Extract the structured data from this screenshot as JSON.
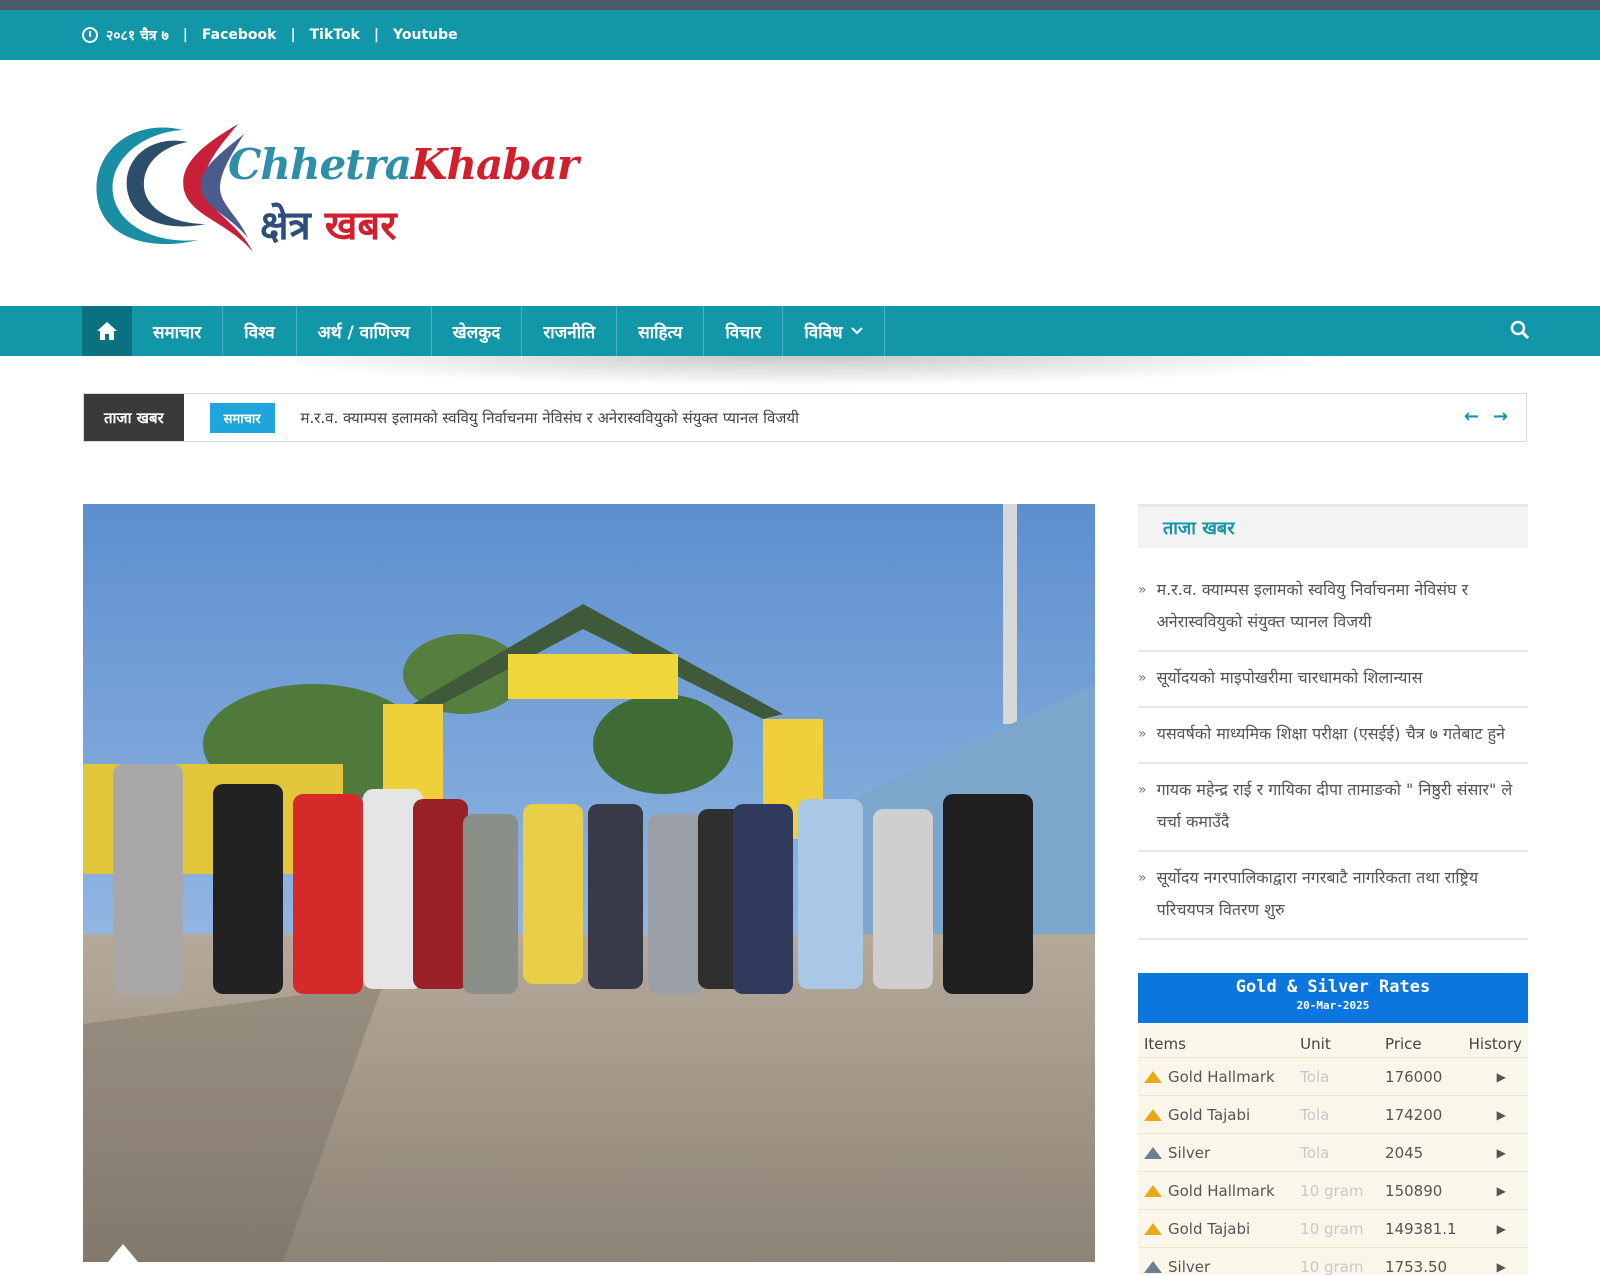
{
  "topbar": {
    "date": "२०८१ चैत्र ७",
    "links": [
      "Facebook",
      "TikTok",
      "Youtube"
    ]
  },
  "logo": {
    "latin_part1": "Chhetra",
    "latin_part2": "Khabar",
    "devanagari_part1": "क्षेत्र",
    "devanagari_part2": "खबर"
  },
  "nav": {
    "items": [
      "समाचार",
      "विश्व",
      "अर्थ / वाणिज्य",
      "खेलकुद",
      "राजनीति",
      "साहित्य",
      "विचार",
      "विविध"
    ]
  },
  "ticker": {
    "label": "ताजा खबर",
    "badge": "समाचार",
    "headline": "म.र.व. क्याम्पस इलामको स्ववियु निर्वाचनमा नेविसंघ र अनेरास्ववियुको संयुक्त प्यानल विजयी"
  },
  "sidebar": {
    "title": "ताजा खबर",
    "news": [
      "म.र.व. क्याम्पस इलामको स्ववियु निर्वाचनमा नेविसंघ र अनेरास्ववियुको संयुक्त प्यानल विजयी",
      "सूर्योदयको माइपोखरीमा चारधामको शिलान्यास",
      "यसवर्षको माध्यमिक शिक्षा परीक्षा (एसईई) चैत्र ७ गतेबाट हुने",
      "गायक महेन्द्र राई र गायिका दीपा तामाङको \" निष्ठुरी संसार\" ले चर्चा कमाउँदै",
      "सूर्योदय नगरपालिकाद्वारा नगरबाटै नागरिकता तथा राष्ट्रिय परिचयपत्र वितरण शुरु"
    ]
  },
  "gold": {
    "title": "Gold & Silver Rates",
    "date": "20-Mar-2025",
    "headers": [
      "Items",
      "Unit",
      "Price",
      "History"
    ],
    "rows": [
      {
        "item": "Gold Hallmark",
        "unit": "Tola",
        "price": "176000",
        "metal": "gold"
      },
      {
        "item": "Gold Tajabi",
        "unit": "Tola",
        "price": "174200",
        "metal": "gold"
      },
      {
        "item": "Silver",
        "unit": "Tola",
        "price": "2045",
        "metal": "silver"
      },
      {
        "item": "Gold Hallmark",
        "unit": "10 gram",
        "price": "150890",
        "metal": "gold"
      },
      {
        "item": "Gold Tajabi",
        "unit": "10 gram",
        "price": "149381.1",
        "metal": "gold"
      },
      {
        "item": "Silver",
        "unit": "10 gram",
        "price": "1753.50",
        "metal": "silver"
      }
    ]
  },
  "colors": {
    "brand_teal": "#1197a8",
    "dark_teal": "#0a7180",
    "brand_red": "#d0202e",
    "gold_header_blue": "#0b76de"
  }
}
